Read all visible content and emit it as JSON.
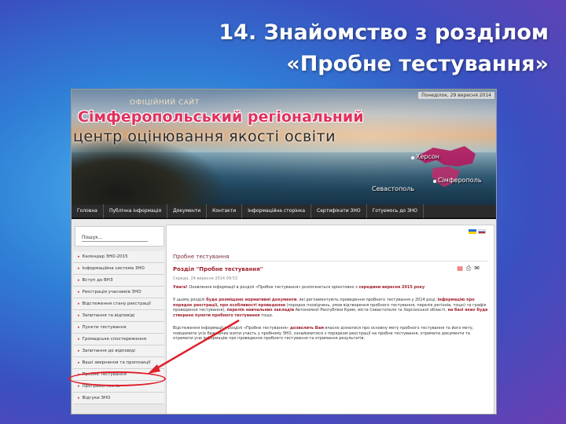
{
  "slide": {
    "title_line1": "14. Знайомство з розділом",
    "title_line2": "«Пробне тестування»"
  },
  "site": {
    "date": "Понеділок, 29 вересня 2014",
    "official": "ОФІЦІЙНИЙ САЙТ",
    "name_line1": "Сімферопольський регіональний",
    "name_line2": "центр оцінювання якості освіти",
    "cities": {
      "kherson": "Херсон",
      "simferopol": "Сімферополь",
      "sevastopol": "Севастополь"
    },
    "nav": [
      "Головна",
      "Публічна інформація",
      "Документи",
      "Контакти",
      "Інформаційна сторінка",
      "Сертифікати ЗНО",
      "Готуємось до ЗНО"
    ],
    "search": {
      "value": "Пошук..."
    },
    "menu": [
      "Календар ЗНО-2015",
      "Інформаційна система ЗНО",
      "Вступ до ВНЗ",
      "Реєстрація учасників ЗНО",
      "Відстеження стану реєстрації",
      "Запитання та відповіді",
      "Пункти тестування",
      "Громадське спостереження",
      "Запитання до відповіді",
      "Ваші звернення та пропозиції",
      "Пробне тестування",
      "Програми тестів",
      "Відгуки ЗНО"
    ],
    "content": {
      "section_title": "Пробне тестування",
      "doc_title": "Розділ \"Пробне тестування\"",
      "meta": "Середа, 24 вересня 2014 09:53",
      "para1_lead": "Увага!",
      "para1": " Оновлення інформації в розділі «Пробне тестування» розпочнеться орієнтовно з ",
      "para1_emph": "середини вересня 2015 року",
      "para2a": "У цьому розділі ",
      "para2_b1": "буде розміщено нормативні документи",
      "para2b": ", які регламентують проведення пробного тестування у 2014 році, ",
      "para2_b2": "інформацію про порядок реєстрації, про особливості проведення",
      "para2c": " (порядок посвідчень, умов відтворення пробного тестування, перелік регіонів, тощо) та графік проведення тестування), ",
      "para2_b3": "перелік навчальних закладів",
      "para2d": " Автономної Республіки Крим, міста Севастополя та Херсонської області, ",
      "para2_b4": "на базі яких буде створено пункти пробного тестування",
      "para2e": " тощо.",
      "para3a": "Відстеження інформації в розділі «Пробне тестування» ",
      "para3_b1": "дозволить Вам",
      "para3b": " вчасно дізнатися про основну мету пробного тестування та його мету, повідомити усіх бажаючих взяти участь у пробному ЗНО, ознайомитися з порядком реєстрації на пробне тестування, отримати документи та отримати усю інформацію про проведення пробного тестування та отримання результатів."
    }
  },
  "colors": {
    "accent_red": "#e0202c",
    "brand_pink": "#e0315e",
    "nav_bg": "#2b2b2b"
  }
}
